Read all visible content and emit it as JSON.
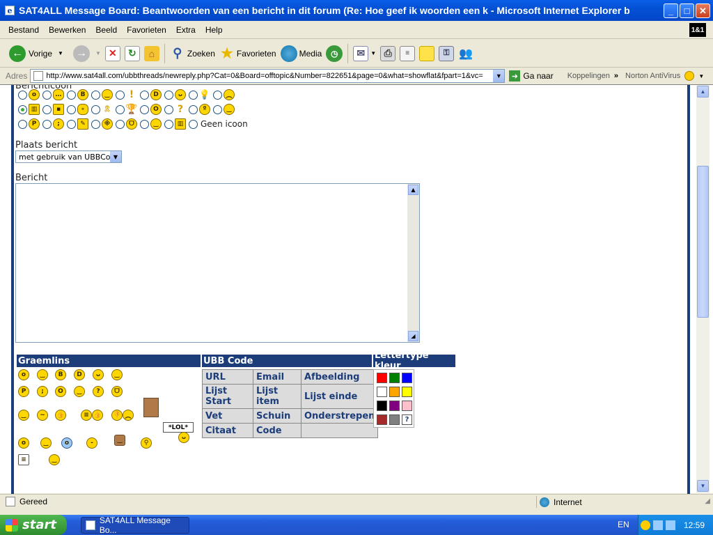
{
  "window": {
    "title": "SAT4ALL Message Board: Beantwoorden van een bericht in dit forum (Re: Hoe geef ik woorden een k - Microsoft Internet Explorer b"
  },
  "menu": [
    "Bestand",
    "Bewerken",
    "Beeld",
    "Favorieten",
    "Extra",
    "Help"
  ],
  "brand_logo": "1&1",
  "toolbar": {
    "back": "Vorige",
    "search": "Zoeken",
    "favorites": "Favorieten",
    "media": "Media"
  },
  "address": {
    "label": "Adres",
    "url": "http://www.sat4all.com/ubbthreads/newreply.php?Cat=0&Board=offtopic&Number=822651&page=0&what=showflat&fpart=1&vc=",
    "go": "Ga naar",
    "links": "Koppelingen",
    "antivirus": "Norton AntiVirus"
  },
  "form": {
    "icons_label_cut": "Berichticoon",
    "geen_icoon": "Geen icoon",
    "plaats_label": "Plaats bericht",
    "plaats_value": "met gebruik van UBBCode",
    "bericht_label": "Bericht"
  },
  "panels": {
    "graemlins": "Graemlins",
    "ubb": "UBB Code",
    "kleur": "Lettertype kleur",
    "lol": "*LOL*",
    "ubb_rows": [
      [
        "URL",
        "Email",
        "Afbeelding"
      ],
      [
        "Lijst Start",
        "Lijst item",
        "Lijst einde"
      ],
      [
        "Vet",
        "Schuin",
        "Onderstrepen"
      ],
      [
        "Citaat",
        "Code",
        ""
      ]
    ],
    "colors": [
      "#ff0000",
      "#008000",
      "#0000ff",
      "#ffffff",
      "#ffa500",
      "#ffff00",
      "#000000",
      "#800080",
      "#ffc0cb",
      "#a52a2a",
      "#808080",
      "?"
    ]
  },
  "status": {
    "text": "Gereed",
    "zone": "Internet"
  },
  "taskbar": {
    "start": "start",
    "item": "SAT4ALL Message Bo...",
    "lang": "EN",
    "time": "12:59"
  }
}
